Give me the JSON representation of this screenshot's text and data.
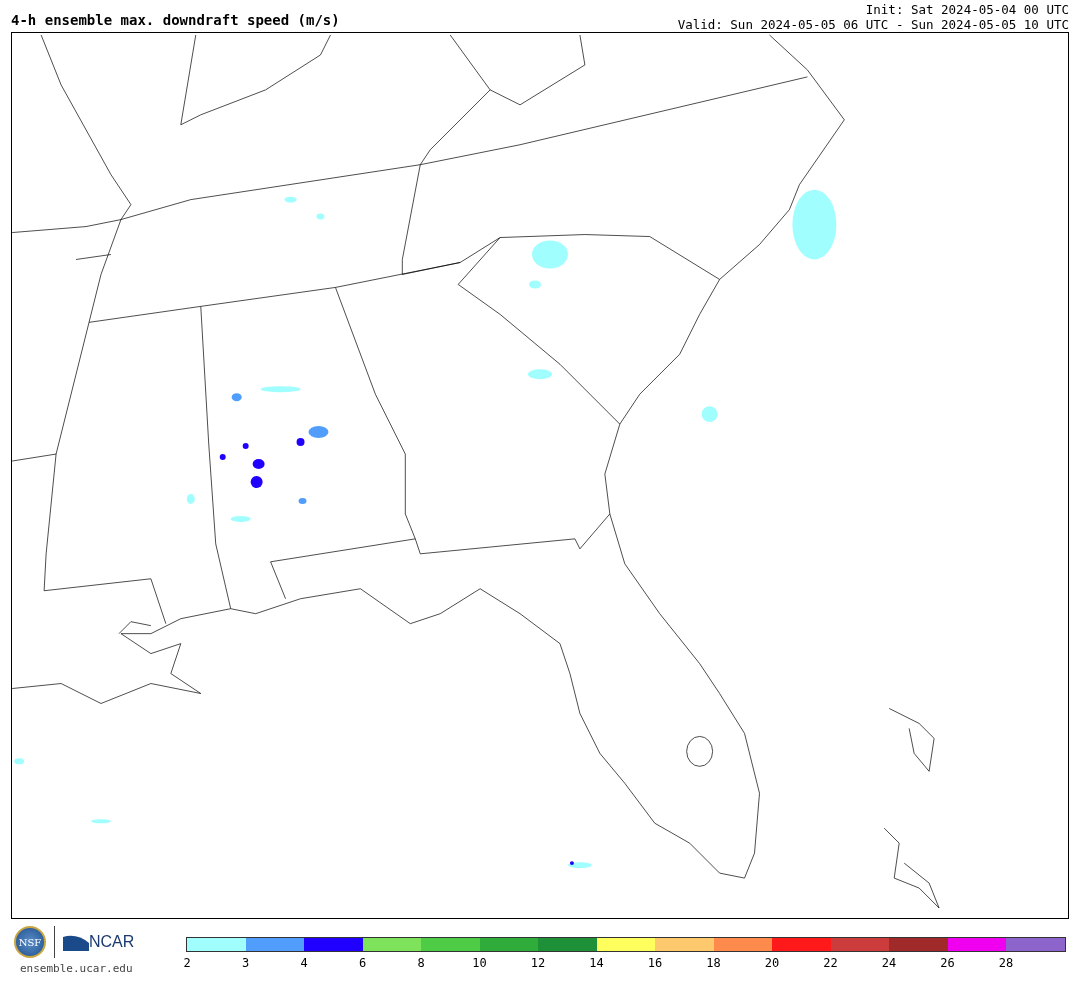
{
  "header": {
    "title": "4-h ensemble max. downdraft speed (m/s)",
    "init": "Init: Sat 2024-05-04 00 UTC",
    "valid": "Valid: Sun 2024-05-05 06 UTC - Sun 2024-05-05 10 UTC"
  },
  "logos": {
    "nsf": "NSF",
    "ncar": "NCAR",
    "url": "ensemble.ucar.edu"
  },
  "colorbar": {
    "segments": [
      {
        "label": "2",
        "color": "#a0fefe"
      },
      {
        "label": "3",
        "color": "#509dfc"
      },
      {
        "label": "4",
        "color": "#2000fe"
      },
      {
        "label": "6",
        "color": "#7ee35a"
      },
      {
        "label": "8",
        "color": "#4fcc45"
      },
      {
        "label": "10",
        "color": "#2fac3a"
      },
      {
        "label": "12",
        "color": "#1e9138"
      },
      {
        "label": "14",
        "color": "#fefe5c"
      },
      {
        "label": "16",
        "color": "#fec96c"
      },
      {
        "label": "18",
        "color": "#fe8a4b"
      },
      {
        "label": "20",
        "color": "#fe1a1a"
      },
      {
        "label": "22",
        "color": "#cc3c3c"
      },
      {
        "label": "24",
        "color": "#a02a2a"
      },
      {
        "label": "26",
        "color": "#ef00ef"
      },
      {
        "label": "28",
        "color": "#8c64cc"
      }
    ]
  }
}
